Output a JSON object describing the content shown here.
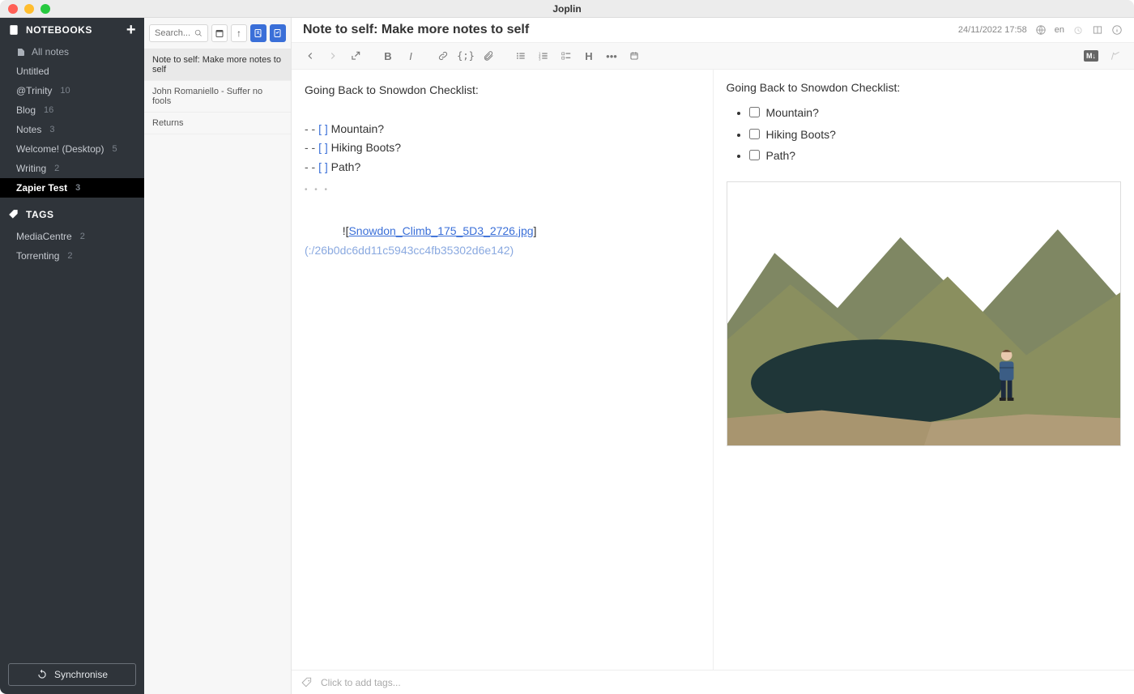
{
  "app": {
    "title": "Joplin"
  },
  "sidebar": {
    "notebooks_label": "NOTEBOOKS",
    "all_notes_label": "All notes",
    "notebooks": [
      {
        "name": "Untitled",
        "count": ""
      },
      {
        "name": "@Trinity",
        "count": "10"
      },
      {
        "name": "Blog",
        "count": "16"
      },
      {
        "name": "Notes",
        "count": "3"
      },
      {
        "name": "Welcome! (Desktop)",
        "count": "5"
      },
      {
        "name": "Writing",
        "count": "2"
      },
      {
        "name": "Zapier Test",
        "count": "3"
      }
    ],
    "selected_notebook_index": 6,
    "tags_label": "TAGS",
    "tags": [
      {
        "name": "MediaCentre",
        "count": "2"
      },
      {
        "name": "Torrenting",
        "count": "2"
      }
    ],
    "sync_label": "Synchronise"
  },
  "notelist": {
    "search_placeholder": "Search...",
    "items": [
      "Note to self: Make more notes to self",
      "John Romaniello - Suffer no fools",
      "Returns"
    ],
    "selected_index": 0
  },
  "note": {
    "title": "Note to self: Make more notes to self",
    "date": "24/11/2022 17:58",
    "lang": "en"
  },
  "editor": {
    "heading": "Going Back to Snowdon Checklist:",
    "checklist": [
      "Mountain?",
      "Hiking Boots?",
      "Path?"
    ],
    "image_ref_text": "Snowdon_Climb_175_5D3_2726.jpg",
    "image_ref_url": "(:/26b0dc6dd11c5943cc4fb35302d6e142)"
  },
  "tags_footer": {
    "placeholder": "Click to add tags..."
  }
}
